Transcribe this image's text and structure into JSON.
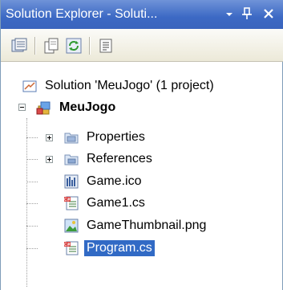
{
  "window": {
    "title": "Solution Explorer - Soluti...",
    "pin_icon": "pin-icon",
    "close_icon": "close-icon",
    "dropdown_icon": "dropdown-arrow-icon"
  },
  "toolbar": {
    "buttons": [
      {
        "name": "properties-button",
        "icon": "properties-icon"
      },
      {
        "name": "show-all-files-button",
        "icon": "show-all-files-icon"
      },
      {
        "name": "refresh-button",
        "icon": "refresh-icon"
      },
      {
        "name": "view-code-button",
        "icon": "view-code-icon"
      }
    ]
  },
  "tree": {
    "solution": {
      "label": "Solution 'MeuJogo' (1 project)",
      "icon": "solution-icon"
    },
    "project": {
      "label": "MeuJogo",
      "icon": "project-icon",
      "expanded": true
    },
    "items": [
      {
        "label": "Properties",
        "icon": "folder-icon",
        "expandable": true
      },
      {
        "label": "References",
        "icon": "references-folder-icon",
        "expandable": true
      },
      {
        "label": "Game.ico",
        "icon": "icon-file-icon",
        "expandable": false
      },
      {
        "label": "Game1.cs",
        "icon": "csharp-file-icon",
        "expandable": false
      },
      {
        "label": "GameThumbnail.png",
        "icon": "image-file-icon",
        "expandable": false
      },
      {
        "label": "Program.cs",
        "icon": "csharp-file-icon",
        "expandable": false,
        "selected": true
      }
    ]
  },
  "colors": {
    "title_bar": "#3c69c4",
    "selection": "#316ac5",
    "toolbar": "#ece9d8"
  }
}
